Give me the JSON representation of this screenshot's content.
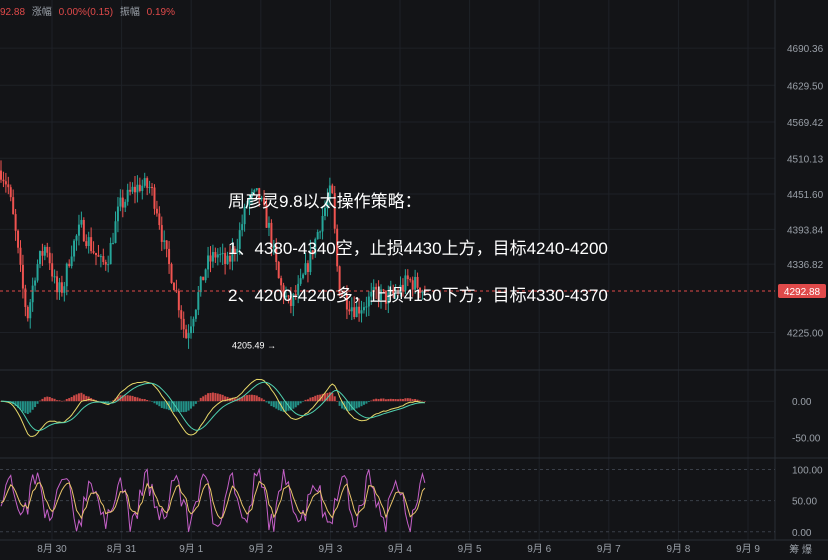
{
  "header": {
    "price": "92.88",
    "change_label": "涨幅",
    "change_value": "0.00%(0.15)",
    "amplitude_label": "振幅",
    "amplitude_value": "0.19%"
  },
  "strategy": {
    "title": "周彦灵9.8以太操作策略：",
    "line1": "1、4380-4340空，止损4430上方，目标4240-4200",
    "line2": "2、4200-4240多，止损4150下方，目标4330-4370"
  },
  "footer": {
    "corner": "筹 爆"
  },
  "colors": {
    "up": "#26a69a",
    "down": "#ef5350",
    "price_line": "#e04a4a",
    "bg": "#131417"
  },
  "chart_data": [
    {
      "type": "candlestick",
      "x_tick_labels": [
        "8月 30",
        "8月 31",
        "9月 1",
        "9月 2",
        "9月 3",
        "9月 4",
        "9月 5",
        "9月 6",
        "9月 7",
        "9月 8",
        "9月 9"
      ],
      "y_ticks": [
        4690.36,
        4629.5,
        4569.42,
        4510.13,
        4451.6,
        4393.84,
        4336.82,
        4225.0
      ],
      "ylim": [
        4180,
        4720
      ],
      "current_price": "4292.88",
      "low_annotation": "4205.49 →",
      "series": [
        {
          "x": 0.0,
          "y": 4490
        },
        {
          "x": 0.1,
          "y": 4465
        },
        {
          "x": 0.2,
          "y": 4395
        },
        {
          "x": 0.3,
          "y": 4305
        },
        {
          "x": 0.38,
          "y": 4250
        },
        {
          "x": 0.5,
          "y": 4330
        },
        {
          "x": 0.65,
          "y": 4370
        },
        {
          "x": 0.8,
          "y": 4290
        },
        {
          "x": 0.9,
          "y": 4300
        },
        {
          "x": 1.0,
          "y": 4358
        },
        {
          "x": 1.15,
          "y": 4398
        },
        {
          "x": 1.3,
          "y": 4365
        },
        {
          "x": 1.45,
          "y": 4335
        },
        {
          "x": 1.55,
          "y": 4352
        },
        {
          "x": 1.7,
          "y": 4430
        },
        {
          "x": 1.9,
          "y": 4458
        },
        {
          "x": 2.0,
          "y": 4466
        },
        {
          "x": 2.15,
          "y": 4462
        },
        {
          "x": 2.25,
          "y": 4425
        },
        {
          "x": 2.35,
          "y": 4360
        },
        {
          "x": 2.5,
          "y": 4300
        },
        {
          "x": 2.6,
          "y": 4250
        },
        {
          "x": 2.65,
          "y": 4215
        },
        {
          "x": 2.8,
          "y": 4272
        },
        {
          "x": 2.95,
          "y": 4335
        },
        {
          "x": 3.1,
          "y": 4355
        },
        {
          "x": 3.25,
          "y": 4335
        },
        {
          "x": 3.4,
          "y": 4375
        },
        {
          "x": 3.55,
          "y": 4442
        },
        {
          "x": 3.7,
          "y": 4450
        },
        {
          "x": 3.85,
          "y": 4395
        },
        {
          "x": 4.0,
          "y": 4305
        },
        {
          "x": 4.15,
          "y": 4268
        },
        {
          "x": 4.3,
          "y": 4300
        },
        {
          "x": 4.45,
          "y": 4350
        },
        {
          "x": 4.6,
          "y": 4410
        },
        {
          "x": 4.75,
          "y": 4460
        },
        {
          "x": 4.85,
          "y": 4300
        },
        {
          "x": 4.95,
          "y": 4280
        },
        {
          "x": 5.1,
          "y": 4262
        },
        {
          "x": 5.25,
          "y": 4275
        },
        {
          "x": 5.4,
          "y": 4290
        },
        {
          "x": 5.55,
          "y": 4280
        },
        {
          "x": 5.7,
          "y": 4292
        },
        {
          "x": 5.85,
          "y": 4310
        },
        {
          "x": 6.0,
          "y": 4302
        },
        {
          "x": 6.1,
          "y": 4293
        }
      ]
    },
    {
      "type": "macd",
      "y_ticks": [
        0.0,
        -50.0
      ],
      "ylim": [
        -75,
        40
      ]
    },
    {
      "type": "oscillator",
      "y_ticks": [
        100.0,
        50.0,
        0.0
      ],
      "ylim": [
        -10,
        112
      ]
    }
  ]
}
